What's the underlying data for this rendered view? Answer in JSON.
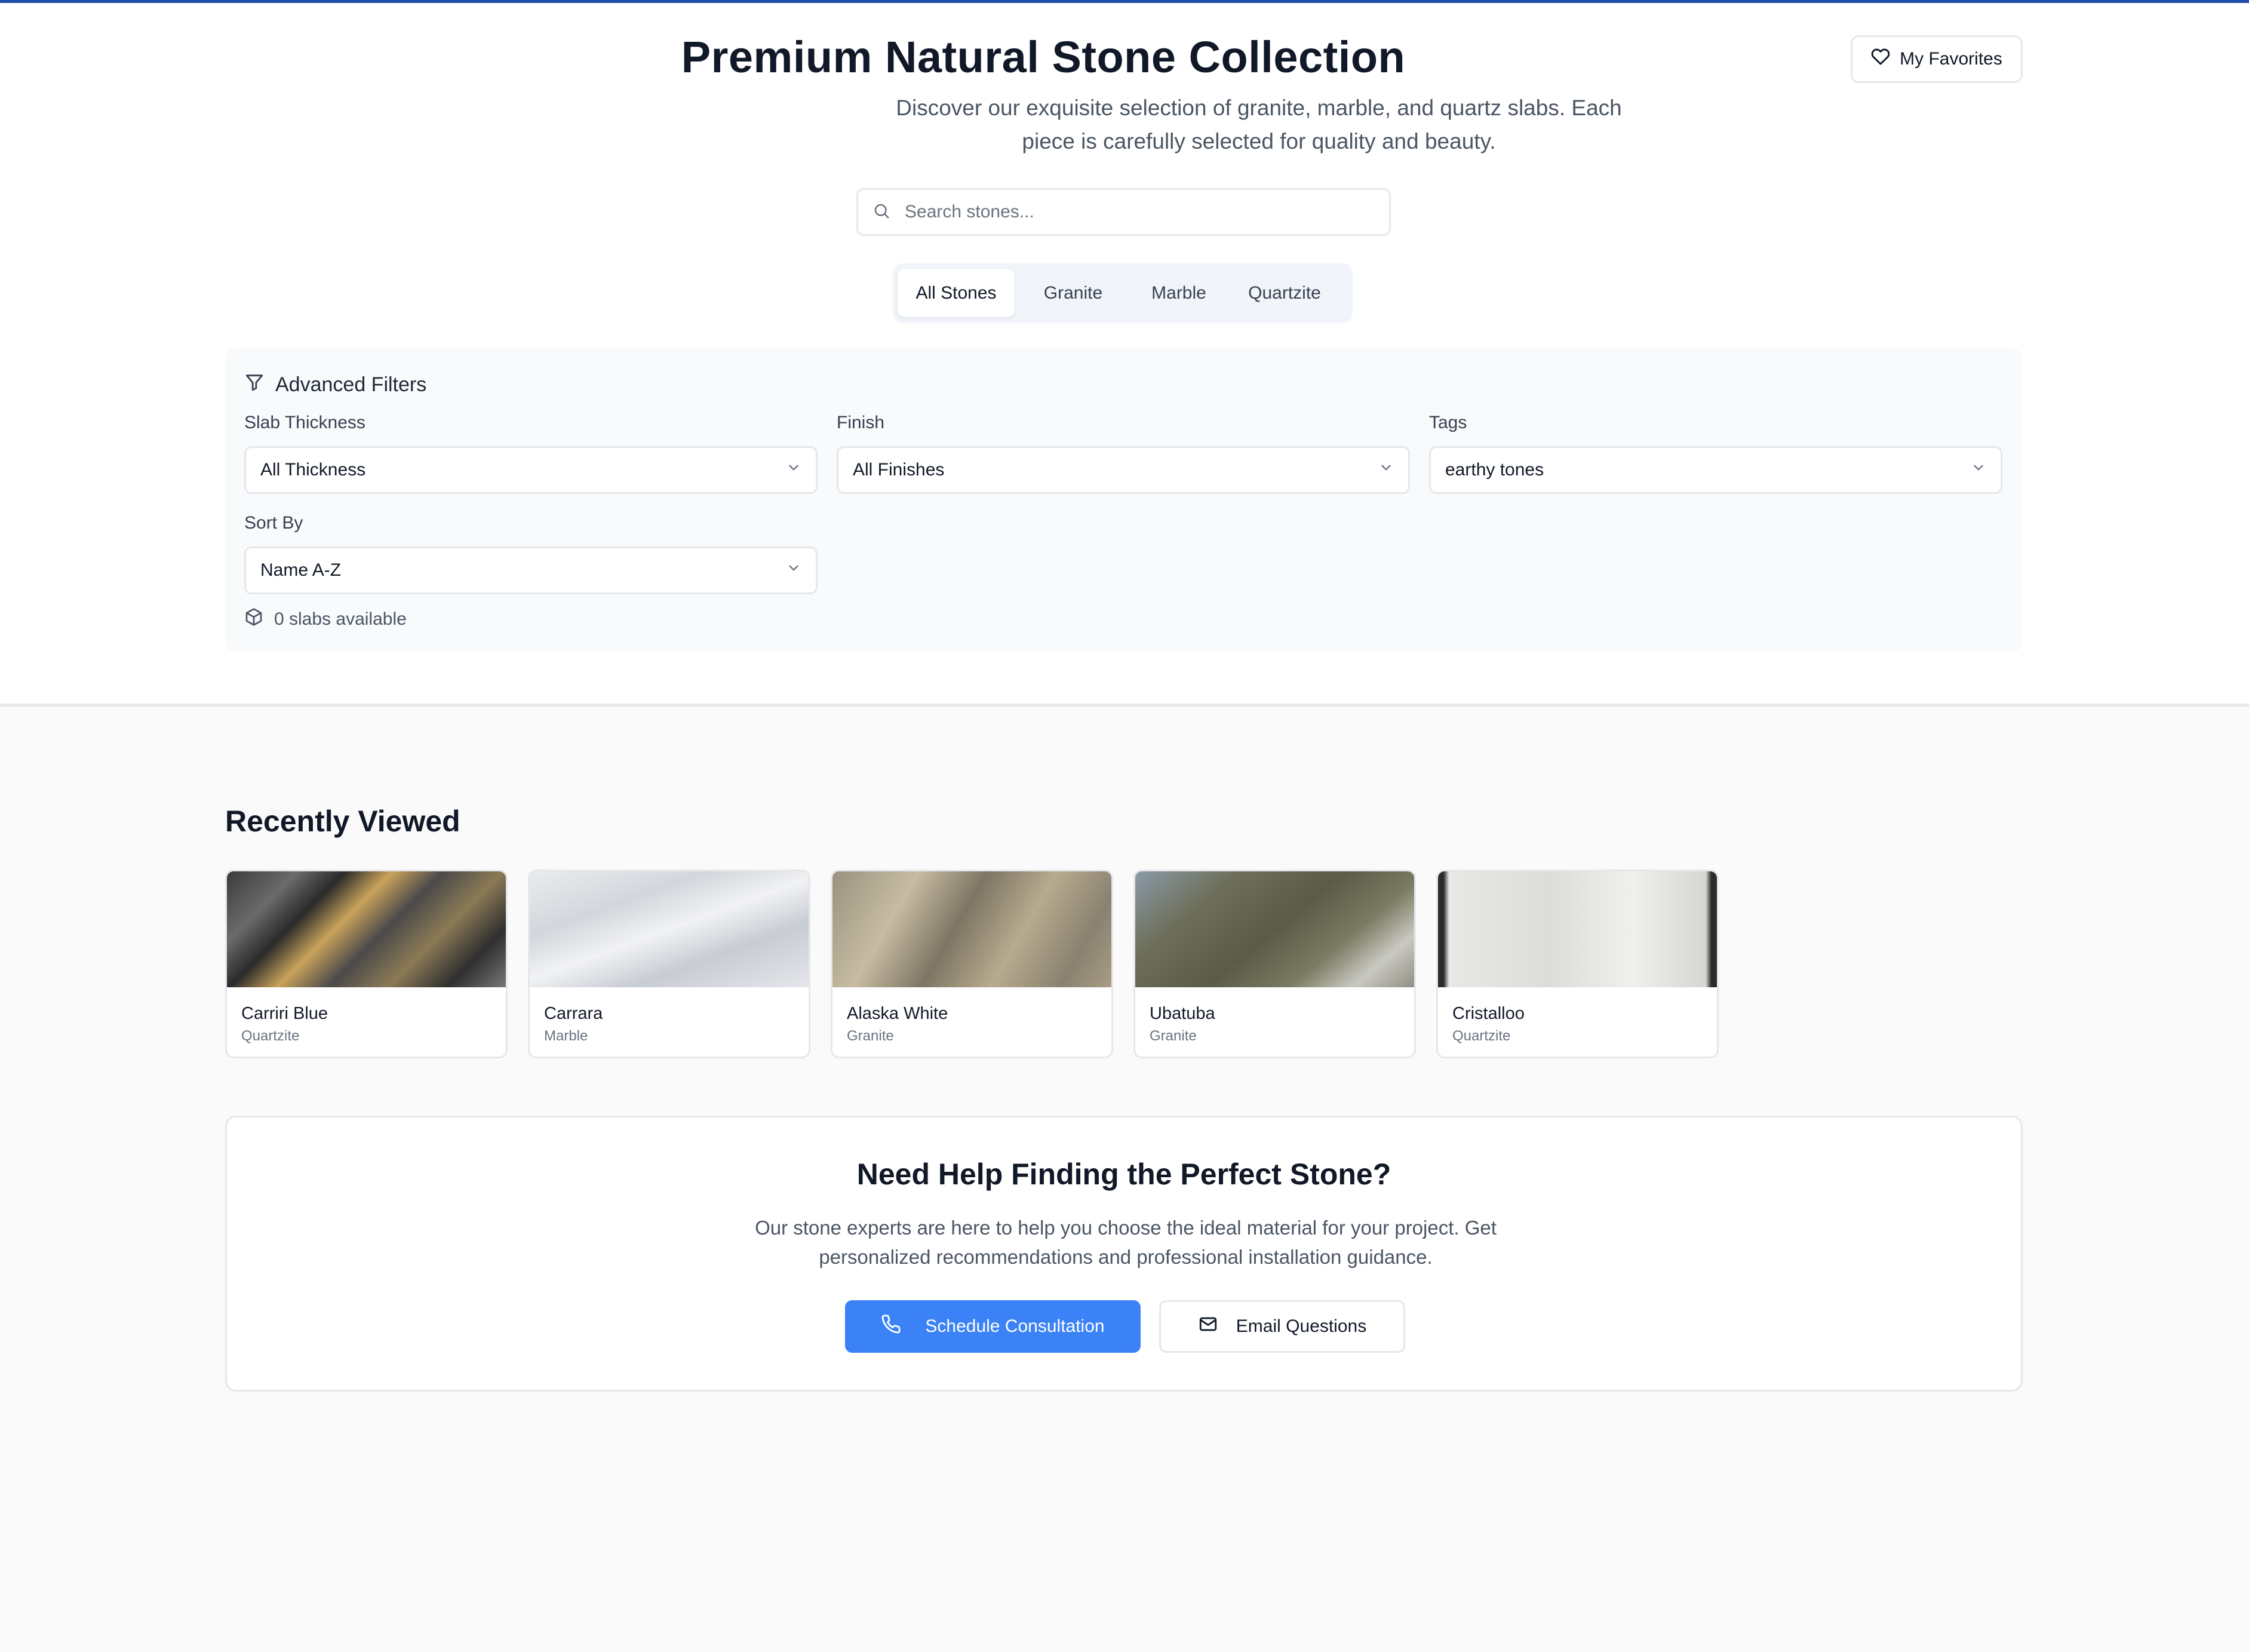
{
  "header": {
    "title": "Premium Natural Stone Collection",
    "subtitle": "Discover our exquisite selection of granite, marble, and quartz slabs. Each piece is carefully selected for quality and beauty.",
    "favorites_label": "My Favorites"
  },
  "search": {
    "placeholder": "Search stones...",
    "value": ""
  },
  "tabs": [
    {
      "label": "All Stones",
      "active": true
    },
    {
      "label": "Granite",
      "active": false
    },
    {
      "label": "Marble",
      "active": false
    },
    {
      "label": "Quartzite",
      "active": false
    }
  ],
  "filters": {
    "heading": "Advanced Filters",
    "thickness": {
      "label": "Slab Thickness",
      "value": "All Thickness"
    },
    "finish": {
      "label": "Finish",
      "value": "All Finishes"
    },
    "tags": {
      "label": "Tags",
      "value": "earthy tones"
    },
    "sort": {
      "label": "Sort By",
      "value": "Name A-Z"
    },
    "count_text": "0 slabs available"
  },
  "recently_viewed": {
    "heading": "Recently Viewed",
    "items": [
      {
        "name": "Carriri Blue",
        "type": "Quartzite"
      },
      {
        "name": "Carrara",
        "type": "Marble"
      },
      {
        "name": "Alaska White",
        "type": "Granite"
      },
      {
        "name": "Ubatuba",
        "type": "Granite"
      },
      {
        "name": "Cristalloo",
        "type": "Quartzite"
      }
    ]
  },
  "help": {
    "title": "Need Help Finding the Perfect Stone?",
    "text": "Our stone experts are here to help you choose the ideal material for your project. Get personalized recommendations and professional installation guidance.",
    "primary_label": "Schedule Consultation",
    "secondary_label": "Email Questions"
  },
  "colors": {
    "accent": "#3b82f6",
    "top_line": "#1e4fa8",
    "text_primary": "#111827",
    "text_muted": "#4b5563"
  },
  "icons": {
    "favorites": "heart-icon",
    "search": "search-icon",
    "filter": "filter-icon",
    "select": "chevron-down-icon",
    "count": "package-icon",
    "phone": "phone-icon",
    "mail": "mail-icon"
  }
}
